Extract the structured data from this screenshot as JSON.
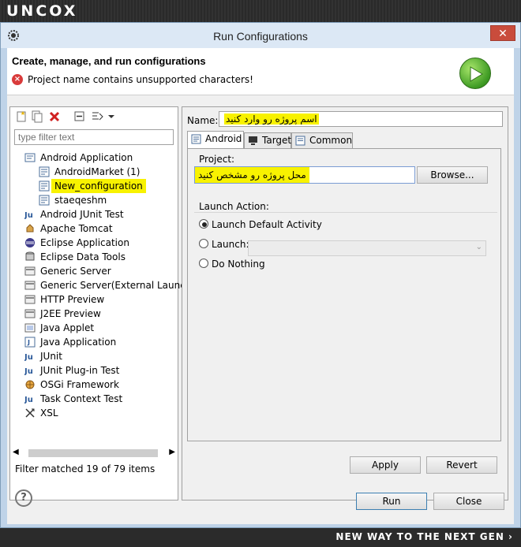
{
  "banner": {
    "brand": "UNCOX",
    "tagline": "NEW WAY TO THE NEXT GEN ›"
  },
  "window": {
    "title": "Run Configurations",
    "close_glyph": "✕"
  },
  "header": {
    "title": "Create, manage, and run configurations",
    "error_icon": "error-x-icon",
    "error_message": "Project name contains unsupported characters!",
    "run_badge_icon": "run-play-icon"
  },
  "left_panel": {
    "toolbar_icons": [
      "new-config-icon",
      "duplicate-icon",
      "delete-icon",
      "collapse-all-icon",
      "filter-icon",
      "dropdown-icon"
    ],
    "filter_placeholder": "type filter text",
    "tree": [
      {
        "label": "Android Application",
        "icon": "android-app-icon",
        "level": 0
      },
      {
        "label": "AndroidMarket (1)",
        "icon": "config-icon",
        "level": 1
      },
      {
        "label": "New_configuration",
        "icon": "config-icon",
        "level": 1,
        "highlighted": true
      },
      {
        "label": "staeqeshm",
        "icon": "config-icon",
        "level": 1
      },
      {
        "label": "Android JUnit Test",
        "icon": "junit-icon",
        "level": 0
      },
      {
        "label": "Apache Tomcat",
        "icon": "tomcat-icon",
        "level": 0
      },
      {
        "label": "Eclipse Application",
        "icon": "eclipse-icon",
        "level": 0
      },
      {
        "label": "Eclipse Data Tools",
        "icon": "data-tools-icon",
        "level": 0
      },
      {
        "label": "Generic Server",
        "icon": "server-icon",
        "level": 0
      },
      {
        "label": "Generic Server(External Launch)",
        "icon": "server-icon",
        "level": 0
      },
      {
        "label": "HTTP Preview",
        "icon": "server-icon",
        "level": 0
      },
      {
        "label": "J2EE Preview",
        "icon": "server-icon",
        "level": 0
      },
      {
        "label": "Java Applet",
        "icon": "applet-icon",
        "level": 0
      },
      {
        "label": "Java Application",
        "icon": "java-app-icon",
        "level": 0
      },
      {
        "label": "JUnit",
        "icon": "junit-icon",
        "level": 0
      },
      {
        "label": "JUnit Plug-in Test",
        "icon": "junit-icon",
        "level": 0
      },
      {
        "label": "OSGi Framework",
        "icon": "osgi-icon",
        "level": 0
      },
      {
        "label": "Task Context Test",
        "icon": "junit-icon",
        "level": 0
      },
      {
        "label": "XSL",
        "icon": "xsl-icon",
        "level": 0
      }
    ],
    "filter_status": "Filter matched 19 of 79 items"
  },
  "right_panel": {
    "name_label": "Name:",
    "name_value": "اسم پروژه رو وارد کنید",
    "tabs": [
      {
        "label": "Android",
        "icon": "android-tab-icon",
        "active": true
      },
      {
        "label": "Target",
        "icon": "target-tab-icon",
        "active": false
      },
      {
        "label": "Common",
        "icon": "common-tab-icon",
        "active": false
      }
    ],
    "project_group_label": "Project:",
    "project_value": "محل پروژه رو مشخص کنید",
    "browse_label": "Browse...",
    "launch_group_label": "Launch Action:",
    "radios": {
      "default_activity": "Launch Default Activity",
      "launch": "Launch:",
      "do_nothing": "Do Nothing"
    },
    "apply_label": "Apply",
    "revert_label": "Revert"
  },
  "footer_buttons": {
    "run_label": "Run",
    "close_label": "Close"
  },
  "colors": {
    "highlight": "#f8f200",
    "accent": "#7a9cd3"
  }
}
